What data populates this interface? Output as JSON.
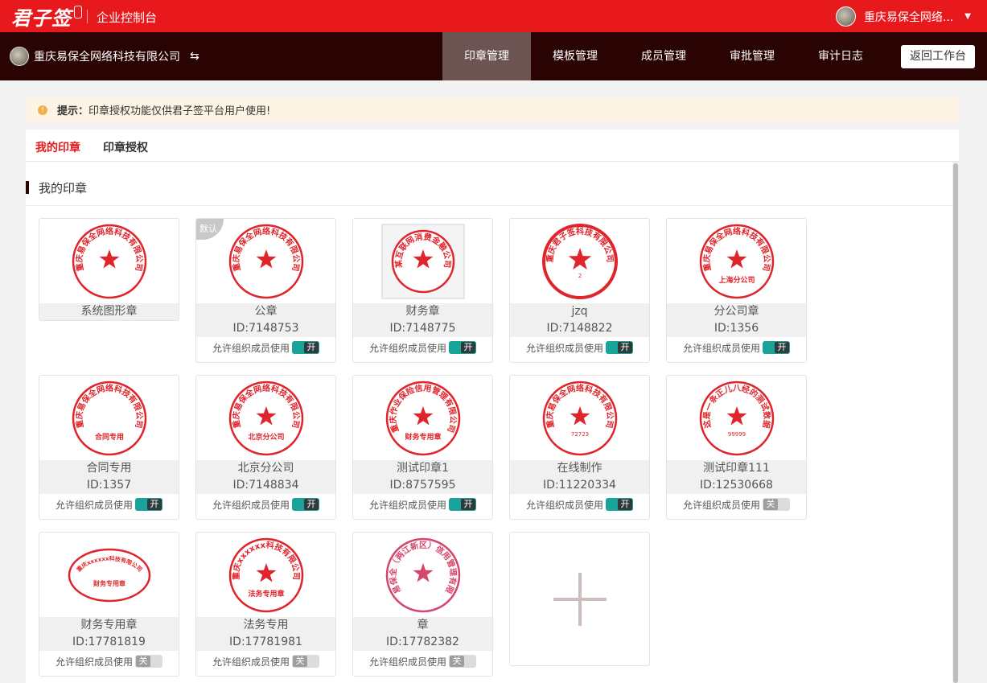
{
  "topbar": {
    "logo_text": "君子签",
    "console_title": "企业控制台",
    "user_name": "重庆易保全网络...",
    "caret_icon": "chevron-down-icon"
  },
  "navbar": {
    "org_name": "重庆易保全网络科技有限公司",
    "switch_symbol": "⇆",
    "items": [
      "印章管理",
      "模板管理",
      "成员管理",
      "审批管理",
      "审计日志"
    ],
    "active_item": "印章管理",
    "back_button": "返回工作台"
  },
  "notice": {
    "icon": "!",
    "label": "提示：",
    "text": "印章授权功能仅供君子签平台用户使用!"
  },
  "tabs": [
    "我的印章",
    "印章授权"
  ],
  "active_tab": "我的印章",
  "section_title": "我的印章",
  "perm_label": "允许组织成员使用",
  "toggle_on_text": "开",
  "toggle_off_text": "关",
  "default_badge": "默认",
  "colors": {
    "brand_red": "#e8191c",
    "nav_dark": "#2a0303",
    "toggle_on": "#1aa39a",
    "stamp_red": "#e0242b"
  },
  "seals": [
    {
      "name": "系统图形章",
      "id": "",
      "toggle": null,
      "stamp": {
        "shape": "circle",
        "ring": "重庆易保全网络科技有限公司",
        "bottom": "",
        "code": ""
      }
    },
    {
      "name": "公章",
      "id": "ID:7148753",
      "toggle": "on",
      "default": true,
      "stamp": {
        "shape": "circle",
        "ring": "重庆易保全网络科技有限公司",
        "bottom": "",
        "code": ""
      }
    },
    {
      "name": "财务章",
      "id": "ID:7148775",
      "toggle": "on",
      "stamp": {
        "shape": "circle",
        "ring": "某互联网消费金融公司",
        "bottom": "",
        "code": "",
        "framed": true
      }
    },
    {
      "name": "jzq",
      "id": "ID:7148822",
      "toggle": "on",
      "stamp": {
        "shape": "circle",
        "ring": "重庆君子签科技有限公司",
        "bottom": "",
        "code": "2",
        "bold": true
      }
    },
    {
      "name": "分公司章",
      "id": "ID:1356",
      "toggle": "on",
      "stamp": {
        "shape": "circle",
        "ring": "重庆易保全网络科技有限公司",
        "bottom": "上海分公司",
        "code": ""
      }
    },
    {
      "name": "合同专用",
      "id": "ID:1357",
      "toggle": "on",
      "stamp": {
        "shape": "circle",
        "ring": "重庆易保全网络科技有限公司",
        "bottom": "合同专用",
        "code": "",
        "nostar": true
      }
    },
    {
      "name": "北京分公司",
      "id": "ID:7148834",
      "toggle": "on",
      "stamp": {
        "shape": "circle",
        "ring": "重庆易保全网络科技有限公司",
        "bottom": "北京分公司",
        "code": ""
      }
    },
    {
      "name": "测试印章1",
      "id": "ID:8757595",
      "toggle": "on",
      "stamp": {
        "shape": "circle",
        "ring": "重庆作业保险信用管理有限公司",
        "bottom": "财务专用章",
        "code": ""
      }
    },
    {
      "name": "在线制作",
      "id": "ID:11220334",
      "toggle": "on",
      "stamp": {
        "shape": "circle",
        "ring": "重庆易保全网络科技有限公司",
        "bottom": "",
        "code": "72723"
      }
    },
    {
      "name": "测试印章111",
      "id": "ID:12530668",
      "toggle": "off",
      "stamp": {
        "shape": "circle",
        "ring": "这是一条正儿八经的测试数据",
        "bottom": "",
        "code": "99999"
      }
    },
    {
      "name": "财务专用章",
      "id": "ID:17781819",
      "toggle": "off",
      "stamp": {
        "shape": "ellipse",
        "ring": "重庆xxxxxx科技有限公司",
        "bottom": "财务专用章",
        "code": ""
      }
    },
    {
      "name": "法务专用",
      "id": "ID:17781981",
      "toggle": "off",
      "stamp": {
        "shape": "circle",
        "ring": "重庆xxxxxx科技有限公司",
        "bottom": "法务专用章",
        "code": ""
      }
    },
    {
      "name": "章",
      "id": "ID:17782382",
      "toggle": "off",
      "stamp": {
        "shape": "circle",
        "ring": "重庆易保全（两江新区）信用管理有限公司",
        "bottom": "",
        "code": "",
        "pink": true
      }
    }
  ],
  "add_icon": "plus-icon"
}
